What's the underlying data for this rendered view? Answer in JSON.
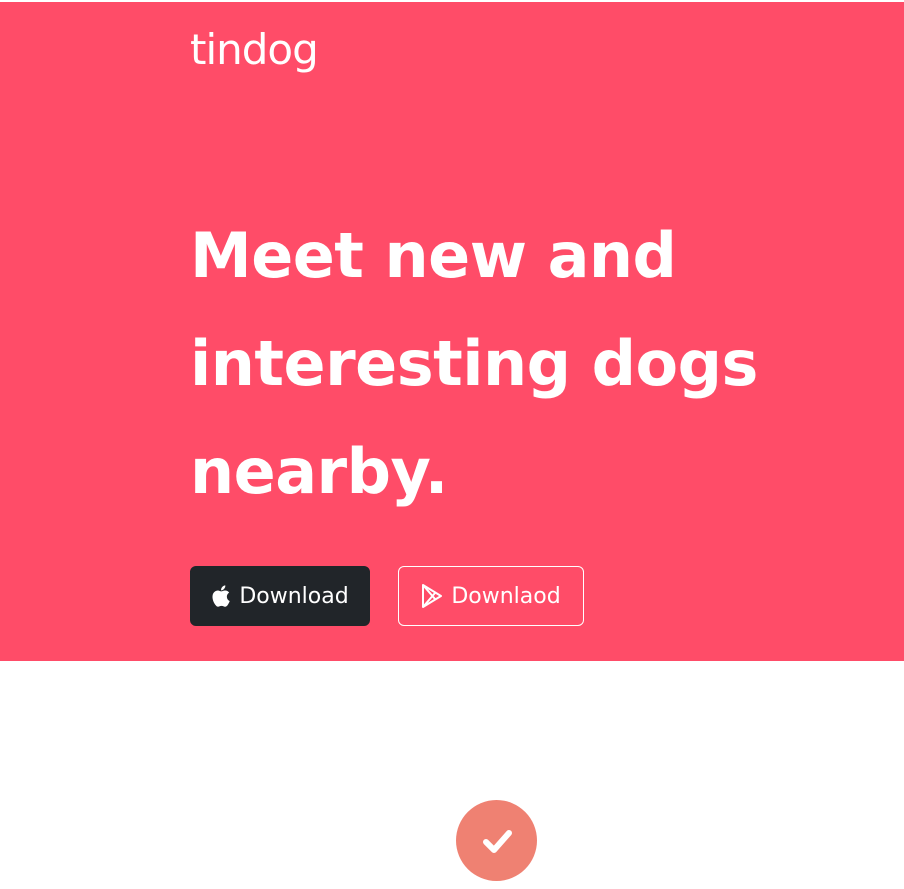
{
  "colors": {
    "hero_background": "#ff4c68",
    "dark_button": "#212529",
    "feature_icon_background": "#ef8172",
    "text": "#ffffff"
  },
  "navbar": {
    "brand": "tindog"
  },
  "hero": {
    "headline": "Meet new and interesting dogs nearby.",
    "buttons": [
      {
        "label": "Download",
        "icon": "apple-icon"
      },
      {
        "label": "Downlaod",
        "icon": "google-play-icon"
      }
    ]
  },
  "features": {
    "first_icon": "check-circle-icon"
  }
}
